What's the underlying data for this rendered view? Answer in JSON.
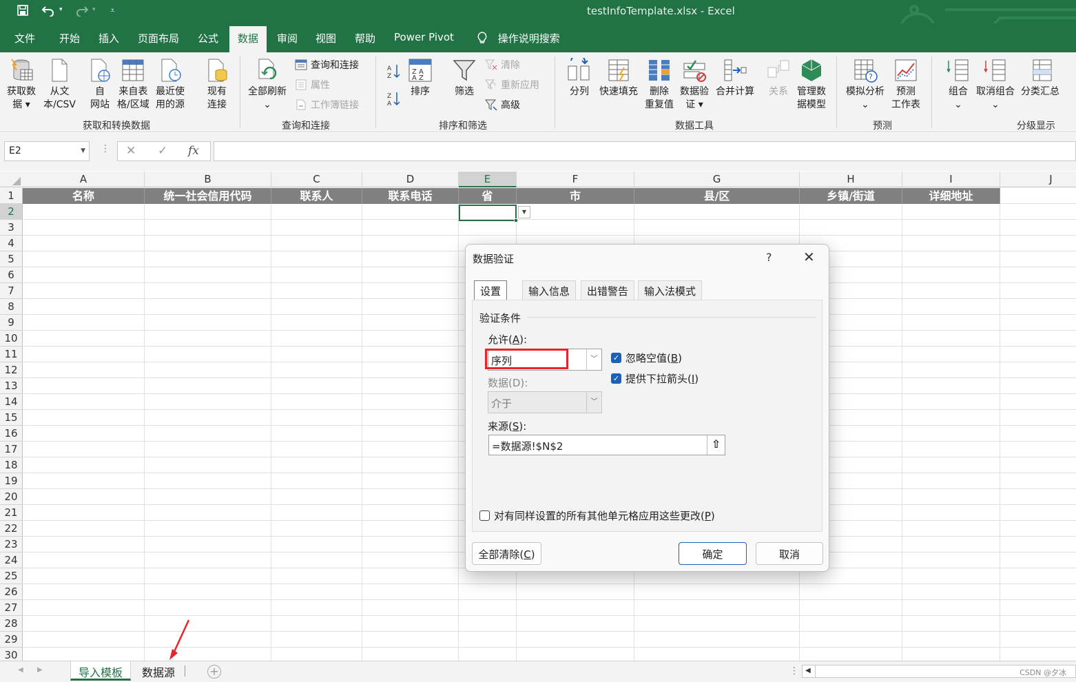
{
  "title_bar": {
    "title": "testInfoTemplate.xlsx  -  Excel"
  },
  "menu": {
    "tabs": [
      "文件",
      "开始",
      "插入",
      "页面布局",
      "公式",
      "数据",
      "审阅",
      "视图",
      "帮助",
      "Power Pivot"
    ],
    "active": "数据",
    "tell_me": "操作说明搜索"
  },
  "ribbon": {
    "get_data": {
      "l1": "获取数",
      "l2": "据 ▾"
    },
    "from_text": {
      "l1": "从文",
      "l2": "本/CSV"
    },
    "from_web": {
      "l1": "自",
      "l2": "网站"
    },
    "from_table": {
      "l1": "来自表",
      "l2": "格/区域"
    },
    "recent_sources": {
      "l1": "最近使",
      "l2": "用的源"
    },
    "existing": {
      "l1": "现有",
      "l2": "连接"
    },
    "group1": "获取和转换数据",
    "refresh_all": {
      "l1": "全部刷新",
      "l2": "⌄"
    },
    "queries": "查询和连接",
    "properties": "属性",
    "edit_links": "工作簿链接",
    "group2": "查询和连接",
    "sort": "排序",
    "filter": "筛选",
    "clear": "清除",
    "reapply": "重新应用",
    "advanced": "高级",
    "group3": "排序和筛选",
    "text_to_columns": "分列",
    "flash_fill": "快速填充",
    "remove_dup": {
      "l1": "删除",
      "l2": "重复值"
    },
    "validation": {
      "l1": "数据验",
      "l2": "证 ▾"
    },
    "consolidate": "合并计算",
    "relationships": "关系",
    "data_model": {
      "l1": "管理数",
      "l2": "据模型"
    },
    "group4": "数据工具",
    "what_if": {
      "l1": "模拟分析",
      "l2": "⌄"
    },
    "forecast": {
      "l1": "预测",
      "l2": "工作表"
    },
    "group5": "预测",
    "group_btn": {
      "l1": "组合",
      "l2": "⌄"
    },
    "ungroup": {
      "l1": "取消组合",
      "l2": "⌄"
    },
    "subtotal": "分类汇总",
    "group6": "分级显示"
  },
  "formula_bar": {
    "name_box": "E2",
    "formula": ""
  },
  "sheet": {
    "columns": [
      "A",
      "B",
      "C",
      "D",
      "E",
      "F",
      "G",
      "H",
      "I",
      "J"
    ],
    "selected_column": "E",
    "rows": [
      "1",
      "2",
      "3",
      "4",
      "5",
      "6",
      "7",
      "8",
      "9",
      "10",
      "11",
      "12",
      "13",
      "14",
      "15",
      "16",
      "17",
      "18",
      "19",
      "20",
      "21",
      "22",
      "23",
      "24",
      "25",
      "26",
      "27",
      "28",
      "29",
      "30"
    ],
    "selected_row": "2",
    "headers": [
      "名称",
      "统一社会信用代码",
      "联系人",
      "联系电话",
      "省",
      "市",
      "县/区",
      "乡镇/街道",
      "详细地址"
    ]
  },
  "dialog": {
    "title": "数据验证",
    "help": "?",
    "close": "✕",
    "tabs": [
      "设置",
      "输入信息",
      "出错警告",
      "输入法模式"
    ],
    "active_tab": "设置",
    "section": "验证条件",
    "allow_label_pre": "允许(",
    "allow_label_key": "A",
    "allow_label_post": "):",
    "allow_value": "序列",
    "data_label": "数据(D):",
    "data_value": "介于",
    "ignore_blank_pre": "忽略空值(",
    "ignore_blank_key": "B",
    "ignore_blank_post": ")",
    "ignore_blank_checked": true,
    "dropdown_pre": "提供下拉箭头(",
    "dropdown_key": "I",
    "dropdown_post": ")",
    "dropdown_checked": true,
    "source_label_pre": "来源(",
    "source_label_key": "S",
    "source_label_post": "):",
    "source_value": "=数据源!$N$2",
    "apply_all_pre": "对有同样设置的所有其他单元格应用这些更改(",
    "apply_all_key": "P",
    "apply_all_post": ")",
    "apply_all_checked": false,
    "clear_all_pre": "全部清除(",
    "clear_all_key": "C",
    "clear_all_post": ")",
    "ok": "确定",
    "cancel": "取消"
  },
  "sheet_tabs": {
    "tabs": [
      "导入模板",
      "数据源"
    ],
    "active": "导入模板",
    "add": "+"
  },
  "watermark": "CSDN @夕冰",
  "colors": {
    "excel_green": "#217346",
    "header_gray": "#808080",
    "highlight_red": "#e8242a",
    "checkbox_blue": "#1a62b8"
  }
}
